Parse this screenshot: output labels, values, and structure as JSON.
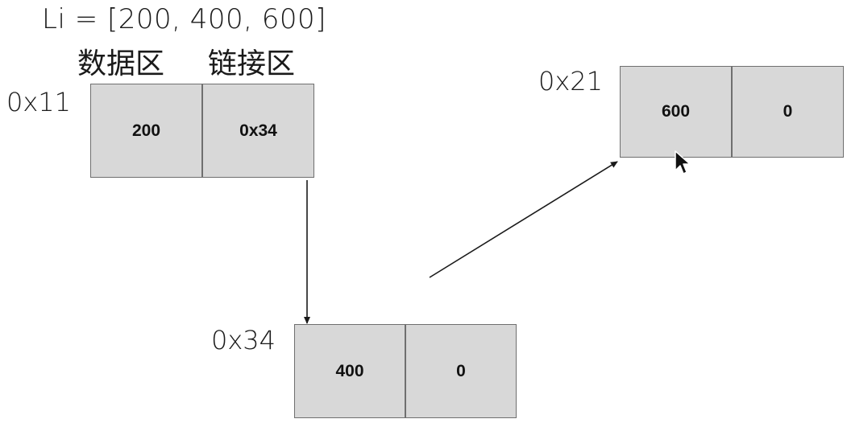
{
  "title": "Li = [200, 400, 600]",
  "labels": {
    "data_area": "数据区",
    "link_area": "链接区"
  },
  "nodes": [
    {
      "address": "0x11",
      "data": "200",
      "next": "0x34"
    },
    {
      "address": "0x34",
      "data": "400",
      "next": "0"
    },
    {
      "address": "0x21",
      "data": "600",
      "next": "0"
    }
  ],
  "colors": {
    "cell_fill": "#d8d8d8",
    "cell_border": "#6f6f6f",
    "arrow": "#1a1a1a"
  },
  "icons": {
    "cursor": "mouse-pointer-icon"
  }
}
